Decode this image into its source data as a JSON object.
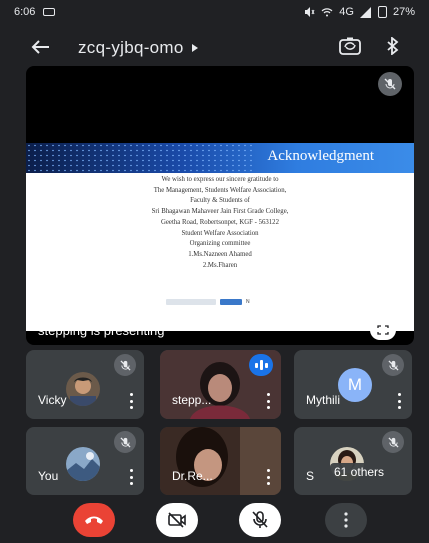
{
  "status_bar": {
    "time": "6:06",
    "network": "4G",
    "battery": "27%"
  },
  "meeting": {
    "code": "zcq-yjbq-omo"
  },
  "presentation": {
    "presenter_label": "stepping is presenting",
    "slide": {
      "heading": "Acknowledgment",
      "lines": [
        "We wish to express our sincere gratitude to",
        "The Management, Students Welfare Association,",
        "Faculty & Students of",
        "Sri Bhagawan Mahaveer Jain First Grade College,",
        "Geetha Road, Robertsonpet, KGF - 563122",
        "Student Welfare Association",
        "Organizing committee",
        "1.Ms.Nazneen Ahamed",
        "2.Ms.Fharen"
      ],
      "footer_mark": "N"
    }
  },
  "participants": [
    {
      "name": "Vicky",
      "muted": true
    },
    {
      "name": "stepp...",
      "muted": false,
      "speaking": true
    },
    {
      "name": "Mythili",
      "muted": true,
      "avatar_letter": "M",
      "avatar_color": "#8ab4f8"
    },
    {
      "name": "You",
      "muted": true
    },
    {
      "name": "Dr.Re...",
      "muted": false
    },
    {
      "name": "S",
      "muted": true
    }
  ],
  "others_badge": "61 others",
  "colors": {
    "background": "#202124",
    "tile": "#3c4043",
    "end_call": "#ea4335",
    "speaking": "#1a73e8"
  },
  "icons": {
    "back": "arrow-left-icon",
    "switch_camera": "switch-camera-icon",
    "bluetooth": "bluetooth-icon",
    "mic_off": "mic-off-icon",
    "fullscreen": "fullscreen-icon",
    "end_call": "phone-hangup-icon",
    "camera_off": "camera-off-icon",
    "more": "more-vert-icon"
  }
}
